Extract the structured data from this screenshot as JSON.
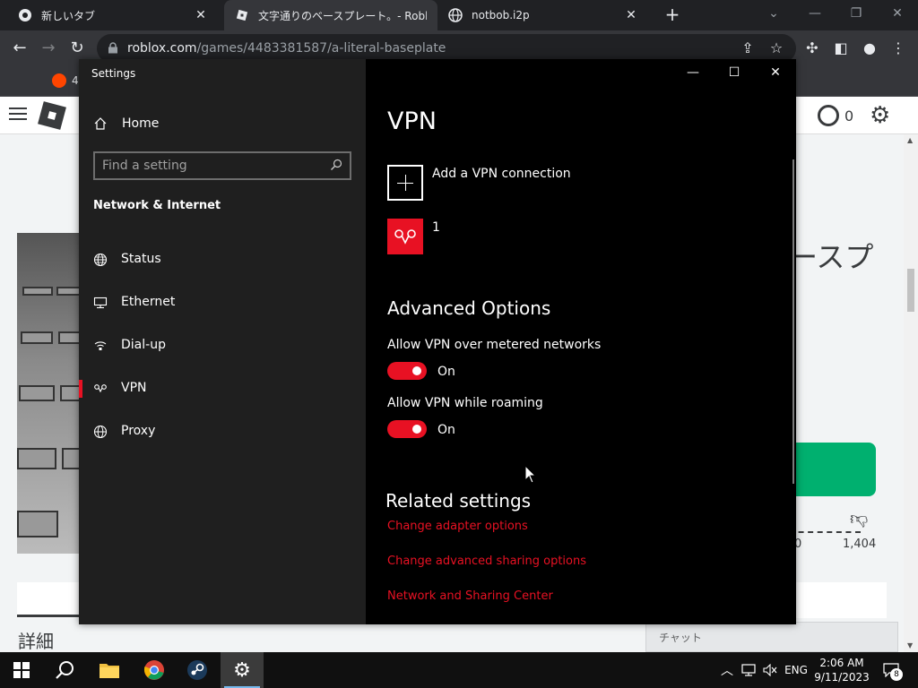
{
  "browser": {
    "tabs": [
      {
        "title": "新しいタブ",
        "close": "✕"
      },
      {
        "title": "文字通りのベースプレート。- Roblox",
        "close": "✕"
      },
      {
        "title": "notbob.i2p",
        "close": "✕"
      }
    ],
    "new_tab": "+",
    "url_host": "roblox.com",
    "url_path": "/games/4483381587/a-literal-baseplate",
    "bookmark_badge": "4"
  },
  "roblox_page": {
    "robux": "0",
    "title_fragment": "ースプ",
    "vote_left": "0",
    "vote_right": "1,404",
    "details_label": "詳細",
    "chat_label": "チャット"
  },
  "settings": {
    "window_title": "Settings",
    "home_label": "Home",
    "search_placeholder": "Find a setting",
    "section_heading": "Network & Internet",
    "nav_items": [
      {
        "label": "Status",
        "icon": "globe-icon"
      },
      {
        "label": "Ethernet",
        "icon": "ethernet-icon"
      },
      {
        "label": "Dial-up",
        "icon": "dialup-icon"
      },
      {
        "label": "VPN",
        "icon": "vpn-icon"
      },
      {
        "label": "Proxy",
        "icon": "globe-icon"
      }
    ],
    "selected_nav": "VPN",
    "caption": {
      "minimize": "—",
      "maximize": "☐",
      "close": "✕"
    },
    "page_heading": "VPN",
    "add_vpn_label": "Add a VPN connection",
    "vpn_connection_name": "1",
    "advanced_heading": "Advanced Options",
    "toggles": [
      {
        "label": "Allow VPN over metered networks",
        "state": "On"
      },
      {
        "label": "Allow VPN while roaming",
        "state": "On"
      }
    ],
    "related_heading": "Related settings",
    "related_links": [
      "Change adapter options",
      "Change advanced sharing options",
      "Network and Sharing Center"
    ],
    "accent_color": "#e81123"
  },
  "taskbar": {
    "language": "ENG",
    "time": "2:06 AM",
    "date": "9/11/2023",
    "notification_count": "8"
  }
}
